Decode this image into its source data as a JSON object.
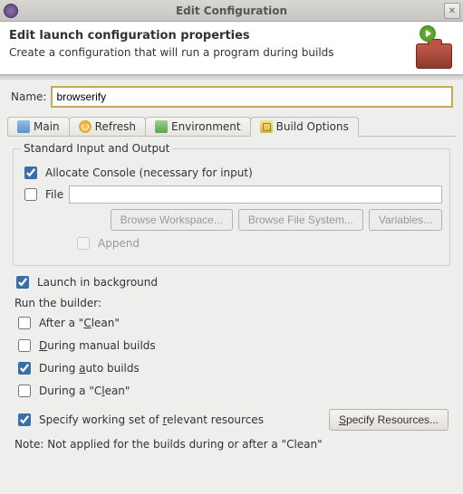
{
  "window": {
    "title": "Edit Configuration",
    "close_glyph": "✕"
  },
  "header": {
    "title": "Edit launch configuration properties",
    "subtitle": "Create a configuration that will run a program during builds"
  },
  "name_field": {
    "label": "Name:",
    "value": "browserify"
  },
  "tabs": {
    "main": "Main",
    "refresh": "Refresh",
    "environment": "Environment",
    "build_options": "Build Options",
    "active": "build_options"
  },
  "build_options": {
    "group_label": "Standard Input and Output",
    "allocate_console": {
      "label": "Allocate Console (necessary for input)",
      "checked": true
    },
    "file": {
      "label": "File",
      "checked": false,
      "value": ""
    },
    "buttons": {
      "browse_workspace": "Browse Workspace...",
      "browse_filesystem": "Browse File System...",
      "variables": "Variables..."
    },
    "append": {
      "label": "Append",
      "checked": false
    },
    "launch_bg": {
      "label": "Launch in background",
      "checked": true
    },
    "run_builder_label": "Run the builder:",
    "after_clean": {
      "label_pre": "After a \"",
      "u": "C",
      "label_post": "lean\"",
      "checked": false
    },
    "during_manual": {
      "label_pre": "",
      "u": "D",
      "label_mid": "uring manual builds",
      "checked": false
    },
    "during_auto": {
      "label_pre": "During ",
      "u": "a",
      "label_post": "uto builds",
      "checked": true
    },
    "during_clean": {
      "label_pre": "During a \"C",
      "u": "l",
      "label_post": "ean\"",
      "checked": false
    },
    "specify_ws": {
      "label_pre": "Specify working set of ",
      "u": "r",
      "label_post": "elevant resources",
      "checked": true
    },
    "specify_btn": {
      "pre": "",
      "u": "S",
      "post": "pecify Resources..."
    },
    "note": "Note: Not applied for the builds during or after a \"Clean\""
  }
}
